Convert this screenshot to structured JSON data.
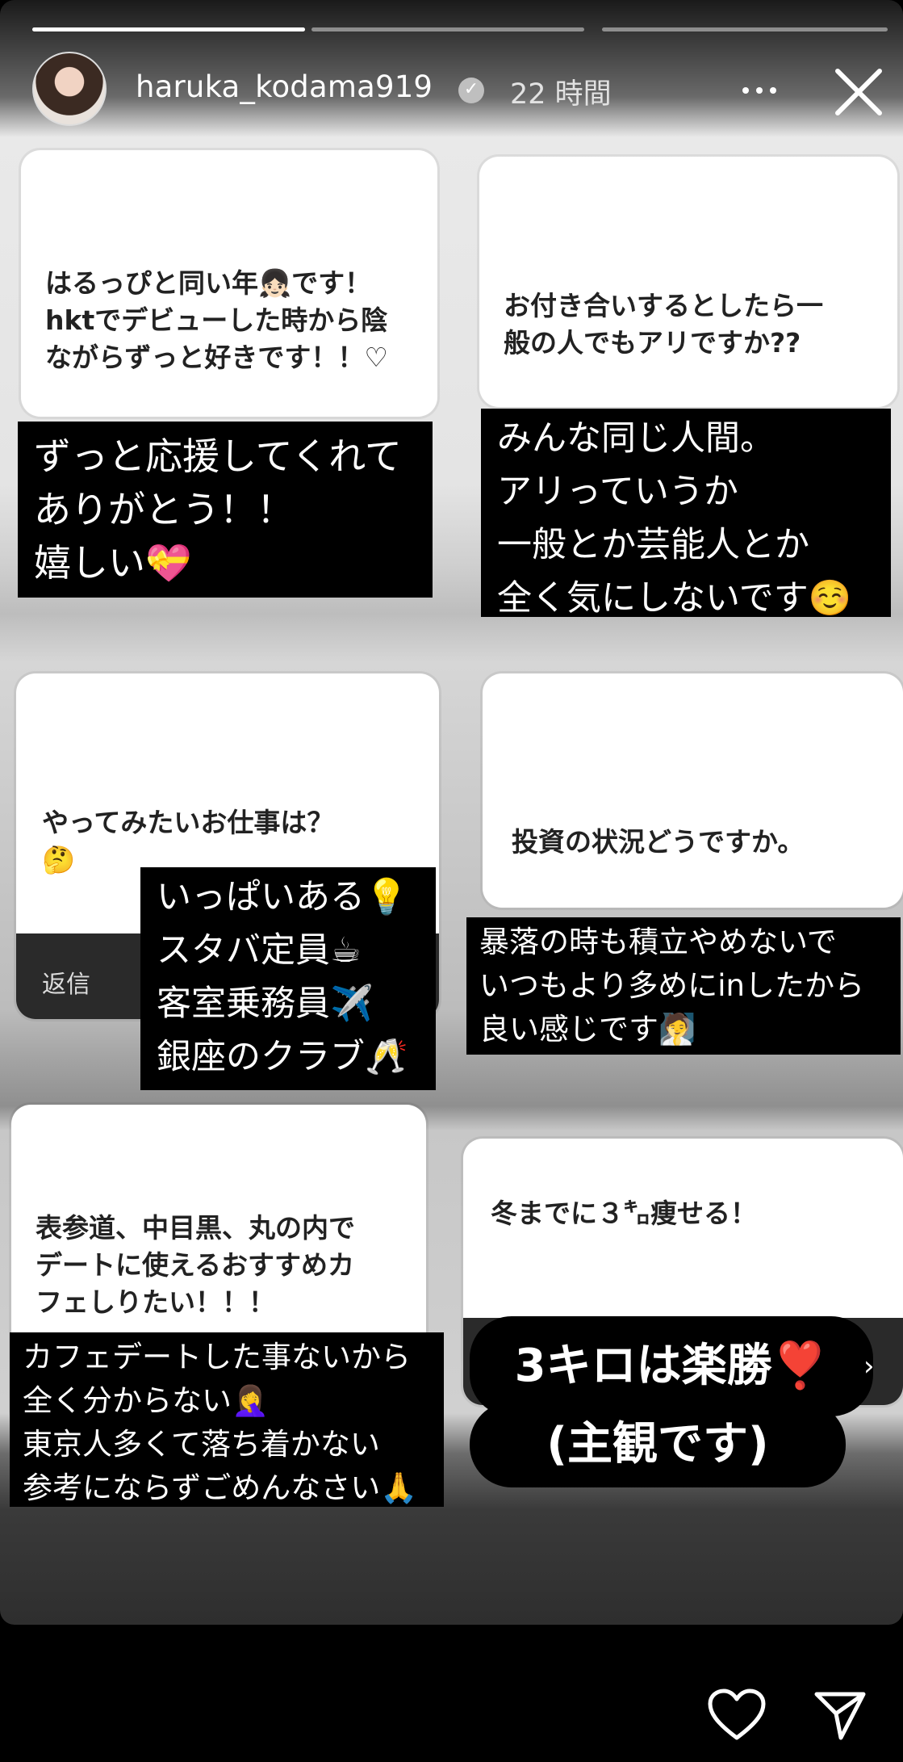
{
  "story": {
    "progress_segments": [
      1,
      0,
      0
    ],
    "username": "haruka_kodama919",
    "time_ago": "22 時間"
  },
  "cards": [
    {
      "question": [
        "はるっぴと同い年👧🏻です！",
        "hktでデビューした時から陰",
        "ながらずっと好きです！！♡"
      ],
      "answer": [
        "ずっと応援してくれて",
        "ありがとう！！",
        "嬉しい💝"
      ]
    },
    {
      "question": [
        "お付き合いするとしたら一",
        "般の人でもアリですか??"
      ],
      "answer": [
        "みんな同じ人間。",
        "アリっていうか",
        "一般とか芸能人とか",
        "全く気にしないです☺️"
      ]
    },
    {
      "question": [
        "やってみたいお仕事は？",
        "🤔"
      ],
      "reply_label": "返信",
      "answer": [
        "いっぱいある💡",
        "スタバ定員☕",
        "客室乗務員✈️",
        "銀座のクラブ🥂"
      ]
    },
    {
      "question": [
        "投資の状況どうですか。"
      ],
      "answer": [
        "暴落の時も積立やめないで",
        "いつもより多めにinしたから",
        "良い感じです🧖"
      ]
    },
    {
      "question": [
        "表参道、中目黒、丸の内で",
        "デートに使えるおすすめカ",
        "フェしりたい！！！"
      ],
      "answer": [
        "カフェデートした事ないから",
        "全く分からない🤦‍♀️",
        "東京人多くて落ち着かない",
        "参考にならずごめんなさい🙏"
      ]
    },
    {
      "question": [
        "冬までに３㌔痩せる！"
      ],
      "answer": [
        "3キロは楽勝❣️",
        "(主観です)"
      ]
    }
  ],
  "icons": {
    "close": "close-icon",
    "more": "more-icon",
    "like": "heart-icon",
    "share": "send-icon",
    "verified": "verified-badge-icon",
    "next": "chevron-right-icon"
  }
}
